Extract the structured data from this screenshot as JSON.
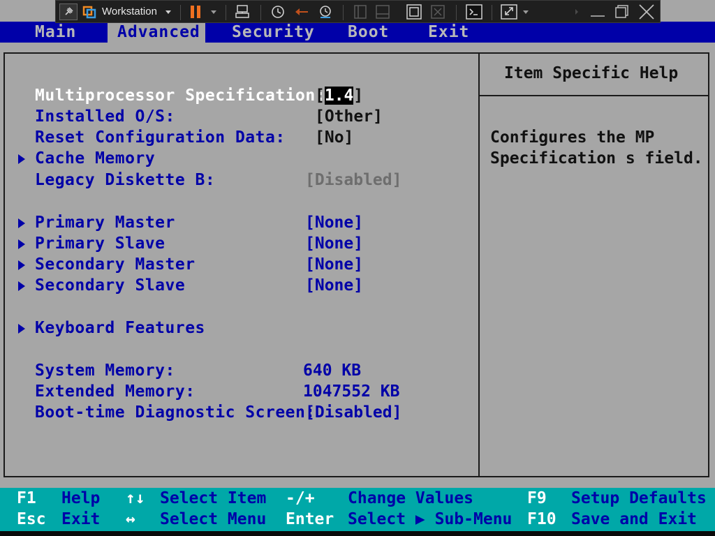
{
  "toolbar": {
    "title": "Workstation",
    "icons": [
      "pin-icon",
      "vmware-logo-icon",
      "dropdown-icon",
      "pause-icon",
      "dropdown-icon",
      "send-keys-icon",
      "snapshot-icon",
      "revert-snapshot-icon",
      "snapshot-manager-icon",
      "sidebar-icon",
      "thumbnail-bar-icon",
      "fullscreen-icon",
      "unity-icon",
      "console-icon",
      "stretch-icon",
      "dropdown-icon",
      "minimize-icon",
      "restore-icon",
      "close-icon"
    ]
  },
  "menu": {
    "items": [
      "Main",
      "Advanced",
      "Security",
      "Boot",
      "Exit"
    ],
    "active": "Advanced"
  },
  "settings": [
    {
      "label": "Multiprocessor Specification:",
      "value_prefix": "[",
      "value_hl": "1.4",
      "value_suffix": "]",
      "arrow": false,
      "selected": true
    },
    {
      "label": "Installed O/S:",
      "value": "[Other]",
      "arrow": false
    },
    {
      "label": "Reset Configuration Data:",
      "value": "[No]",
      "arrow": false
    },
    {
      "label": "Cache Memory",
      "arrow": true
    },
    {
      "label": "Legacy Diskette B:",
      "value": "[Disabled]",
      "arrow": false,
      "disabled": true
    },
    {
      "label": "Primary Master",
      "value": "[None]",
      "arrow": true
    },
    {
      "label": "Primary Slave",
      "value": "[None]",
      "arrow": true
    },
    {
      "label": "Secondary Master",
      "value": "[None]",
      "arrow": true
    },
    {
      "label": "Secondary Slave",
      "value": "[None]",
      "arrow": true
    },
    {
      "label": "Keyboard Features",
      "arrow": true
    },
    {
      "label": "System Memory:",
      "value": "640 KB",
      "arrow": false
    },
    {
      "label": "Extended Memory:",
      "value": "1047552 KB",
      "arrow": false
    },
    {
      "label": "Boot-time Diagnostic Screen:",
      "value": "[Disabled]",
      "arrow": false
    }
  ],
  "help": {
    "title": "Item Specific Help",
    "lines": [
      "Configures the MP",
      "Specification s field."
    ]
  },
  "bottom": {
    "row1": [
      {
        "key": "F1",
        "desc": "Help"
      },
      {
        "key": "↑↓",
        "desc": "Select Item"
      },
      {
        "key": "-/+",
        "desc": "Change Values"
      },
      {
        "key": "F9",
        "desc": "Setup Defaults"
      }
    ],
    "row2": [
      {
        "key": "Esc",
        "desc": "Exit"
      },
      {
        "key": "↔",
        "desc": "Select Menu"
      },
      {
        "key": "Enter",
        "desc": "Select ▶ Sub-Menu"
      },
      {
        "key": "F10",
        "desc": "Save and Exit"
      }
    ]
  },
  "colors": {
    "menubar_bg": "#0000a8",
    "panel_bg": "#a6a6a6",
    "bottom_bg": "#00a8a8",
    "label_blue": "#0000a8",
    "selected_white": "#ffffff"
  }
}
